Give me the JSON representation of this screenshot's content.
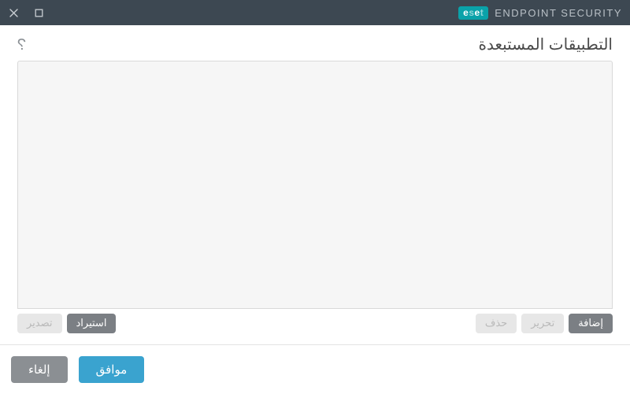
{
  "brand": {
    "logo_text": "eset",
    "product": "ENDPOINT SECURITY"
  },
  "dialog": {
    "title": "التطبيقات المستبعدة"
  },
  "toolbar": {
    "add": "إضافة",
    "edit": "تحرير",
    "remove": "حذف",
    "import": "استيراد",
    "export": "تصدير"
  },
  "footer": {
    "ok": "موافق",
    "cancel": "إلغاء"
  },
  "list": {
    "items": []
  }
}
